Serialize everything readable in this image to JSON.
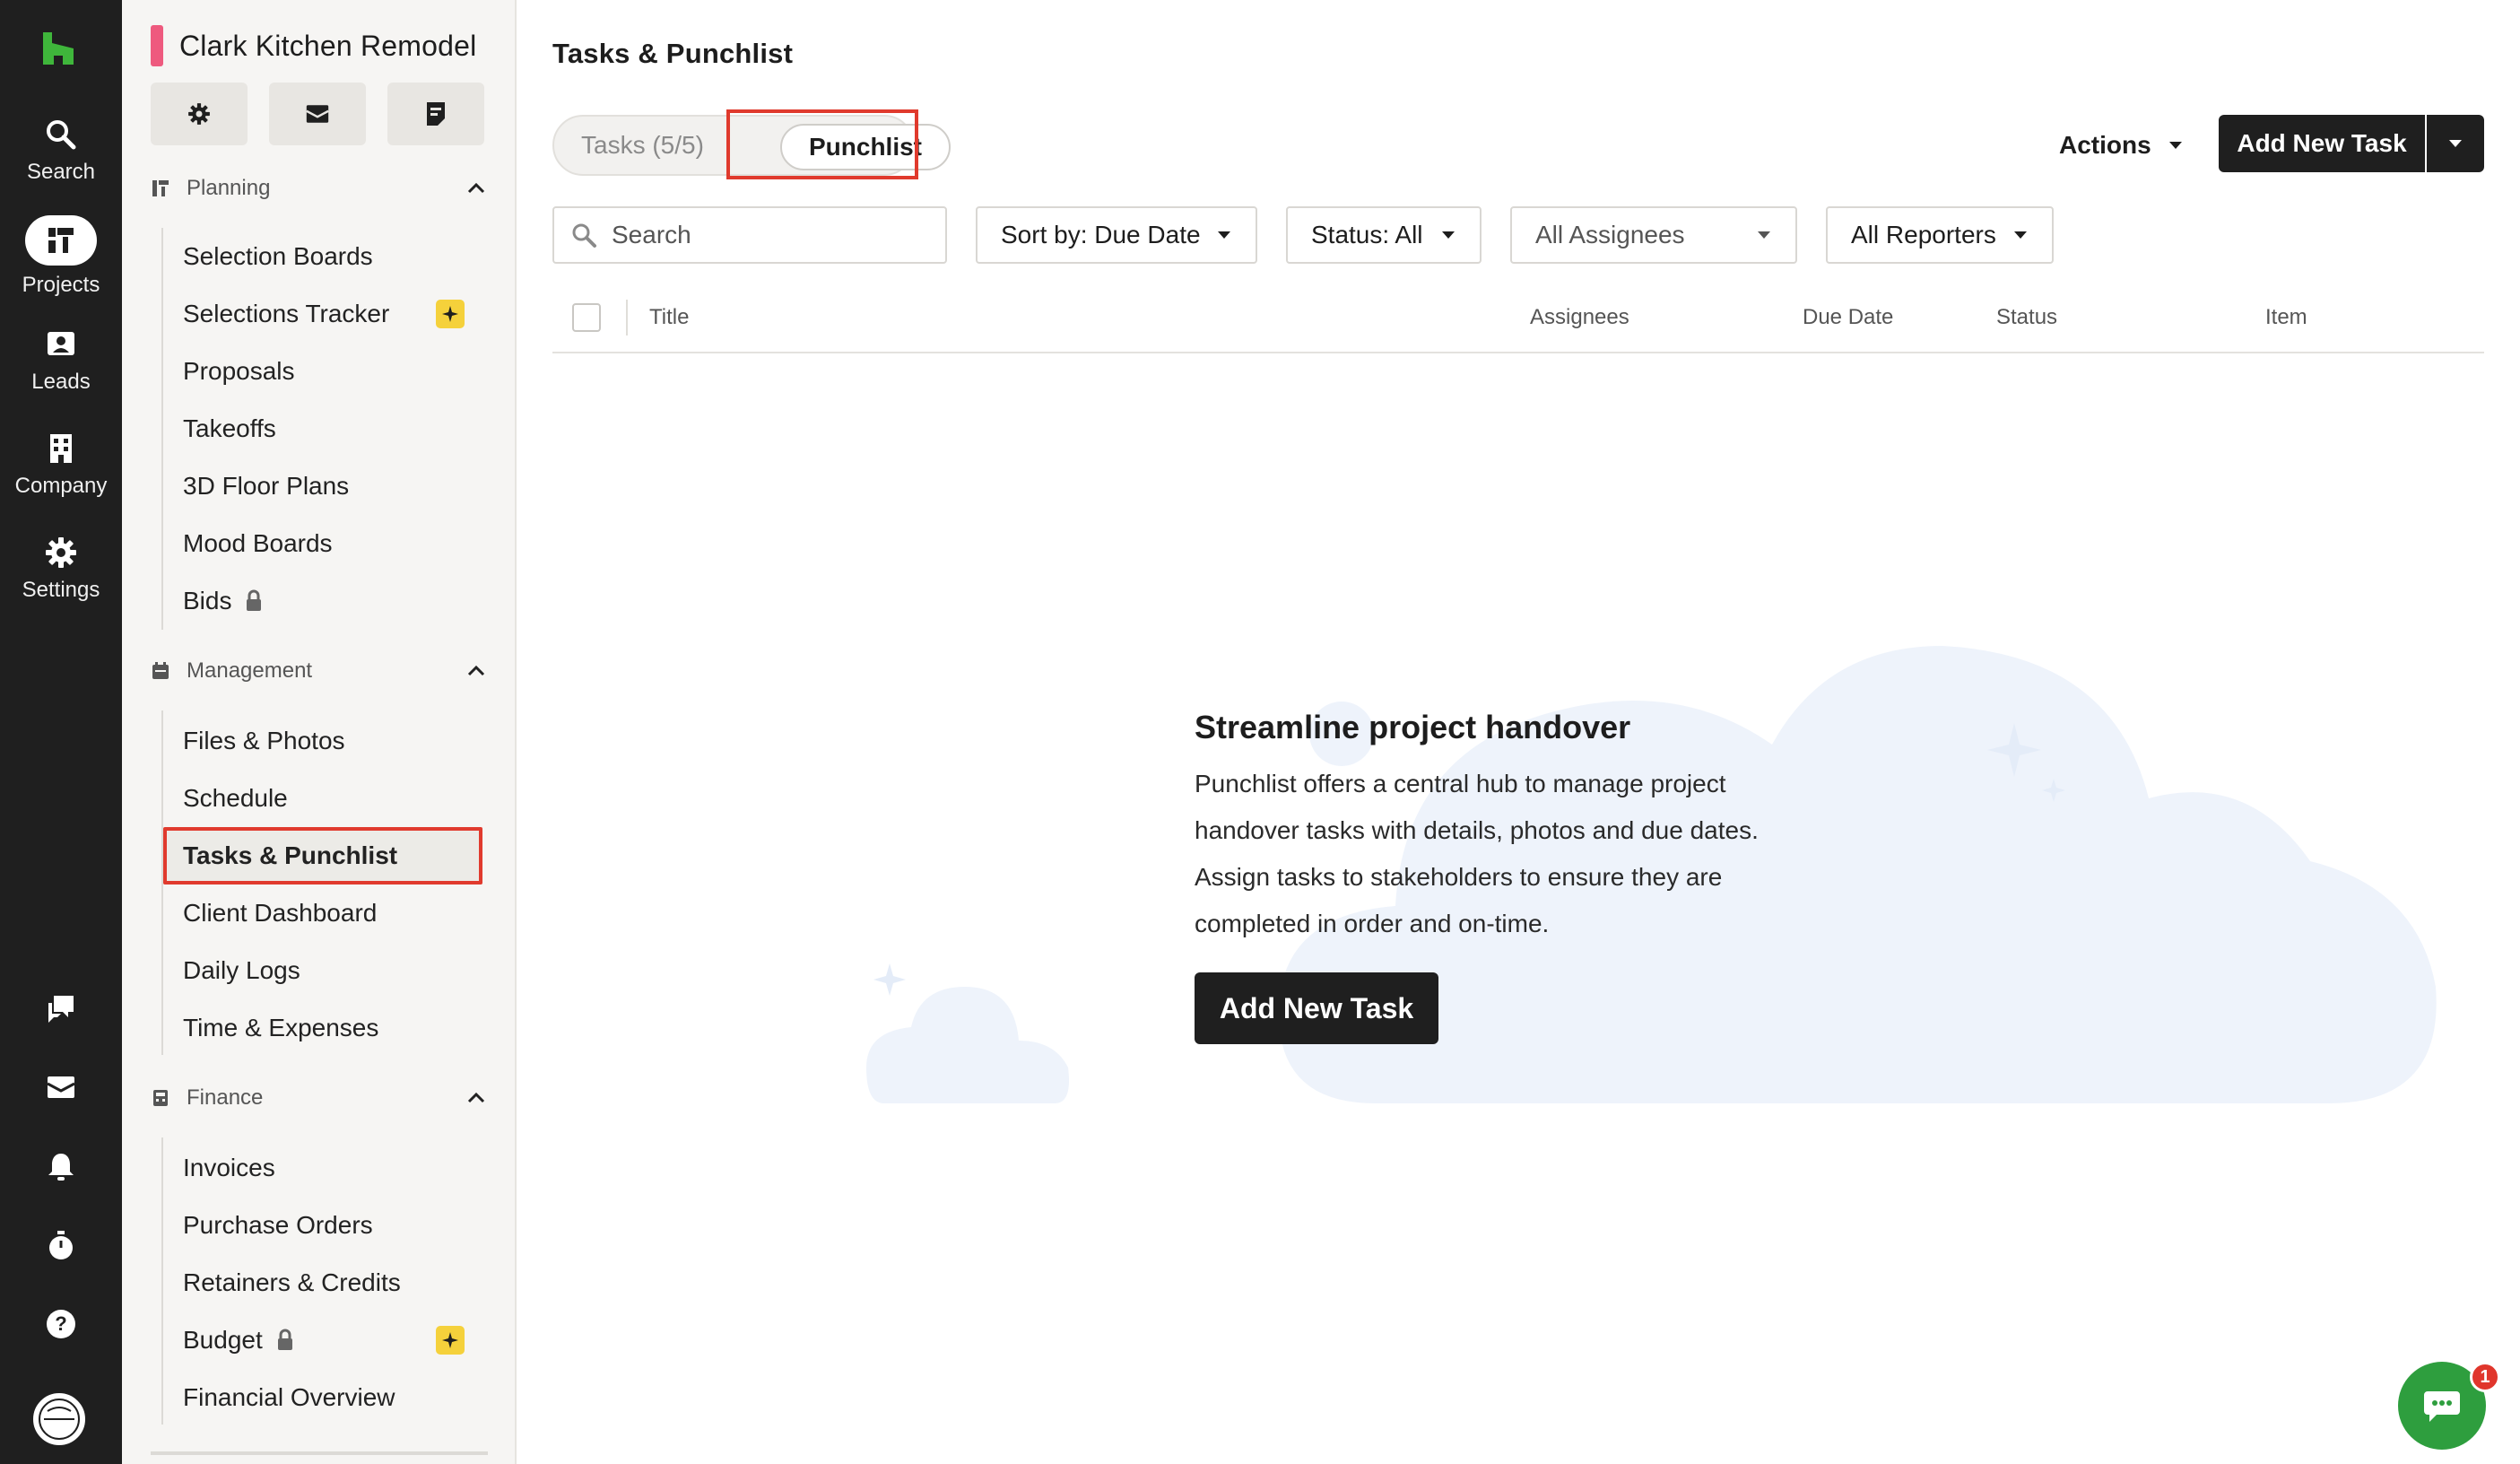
{
  "rail": {
    "items": [
      {
        "label": "Search",
        "icon": "search-icon"
      },
      {
        "label": "Projects",
        "icon": "projects-icon"
      },
      {
        "label": "Leads",
        "icon": "leads-icon"
      },
      {
        "label": "Company",
        "icon": "company-icon"
      },
      {
        "label": "Settings",
        "icon": "gear-icon"
      }
    ],
    "bottom_icons": [
      "chat-bubbles-icon",
      "inbox-icon",
      "bell-icon",
      "timer-icon",
      "help-icon"
    ],
    "brand_color": "#3fb63b"
  },
  "sidebar": {
    "project_name": "Clark Kitchen Remodel",
    "project_color": "#ee5a7e",
    "quick_actions": [
      "gear-icon",
      "mail-icon",
      "notes-icon"
    ],
    "sections": [
      {
        "label": "Planning",
        "items": [
          {
            "label": "Selection Boards"
          },
          {
            "label": "Selections Tracker",
            "badge": "sparkle"
          },
          {
            "label": "Proposals"
          },
          {
            "label": "Takeoffs"
          },
          {
            "label": "3D Floor Plans"
          },
          {
            "label": "Mood Boards"
          },
          {
            "label": "Bids",
            "locked": true
          }
        ]
      },
      {
        "label": "Management",
        "items": [
          {
            "label": "Files & Photos"
          },
          {
            "label": "Schedule"
          },
          {
            "label": "Tasks & Punchlist",
            "current": true
          },
          {
            "label": "Client Dashboard"
          },
          {
            "label": "Daily Logs"
          },
          {
            "label": "Time & Expenses"
          }
        ]
      },
      {
        "label": "Finance",
        "items": [
          {
            "label": "Invoices"
          },
          {
            "label": "Purchase Orders"
          },
          {
            "label": "Retainers & Credits"
          },
          {
            "label": "Budget",
            "locked": true,
            "badge": "sparkle"
          },
          {
            "label": "Financial Overview"
          }
        ]
      }
    ]
  },
  "main": {
    "title": "Tasks & Punchlist",
    "tabs": [
      {
        "label": "Tasks (5/5)",
        "active": false
      },
      {
        "label": "Punchlist",
        "active": true
      }
    ],
    "actions_label": "Actions",
    "add_task_label": "Add New Task",
    "search_placeholder": "Search",
    "filters": {
      "sort": "Sort by: Due Date",
      "status": "Status: All",
      "assignees": "All Assignees",
      "reporters": "All Reporters"
    },
    "columns": [
      "Title",
      "Assignees",
      "Due Date",
      "Status",
      "Item"
    ],
    "empty_state": {
      "title": "Streamline project handover",
      "body_lines": [
        "Punchlist offers a central hub to manage project",
        "handover tasks with details, photos and due dates.",
        "Assign tasks to stakeholders to ensure they are",
        "completed in order and on-time."
      ],
      "button": "Add New Task"
    }
  },
  "chat": {
    "badge_count": "1",
    "color": "#2e9e3e"
  }
}
